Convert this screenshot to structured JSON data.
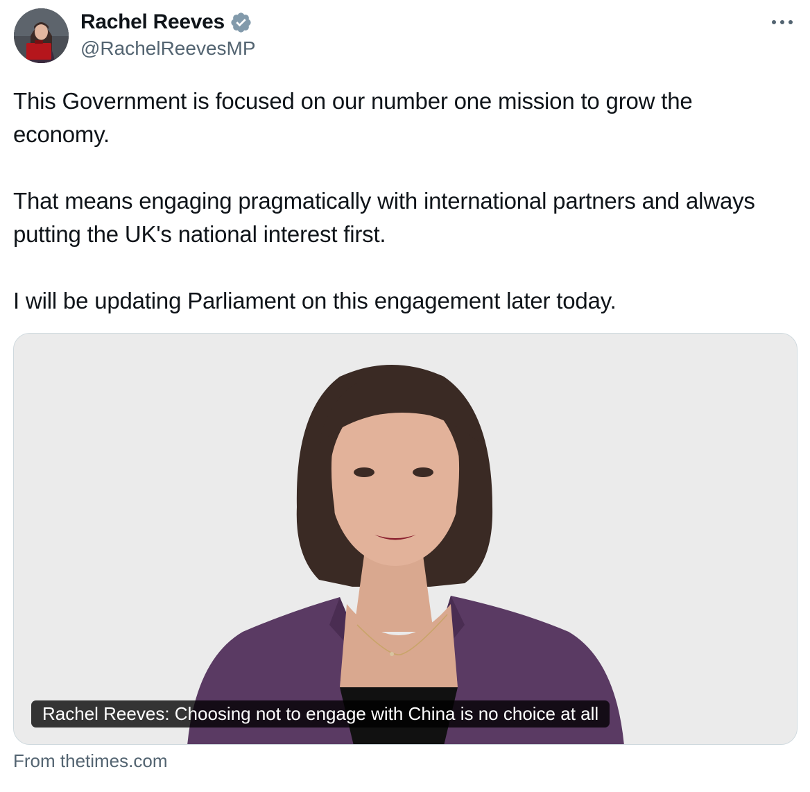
{
  "author": {
    "display_name": "Rachel Reeves",
    "handle": "@RachelReevesMP",
    "verified_icon": "verified-badge-icon",
    "verified_color": "#829aab"
  },
  "more_icon": "more-options-icon",
  "tweet": {
    "paragraphs": [
      "This Government is focused on our number one mission to grow the economy.",
      "That means engaging pragmatically with international partners and always putting the UK's national interest first.",
      "I will be updating Parliament on this engagement later today."
    ]
  },
  "card": {
    "title": "Rachel Reeves: Choosing not to engage with China is no choice at all",
    "source": "From thetimes.com"
  },
  "colors": {
    "text": "#0f1419",
    "secondary": "#536471",
    "card_border": "#cfd9de",
    "card_bg": "#ebebeb",
    "jacket": "#5a3a63"
  }
}
